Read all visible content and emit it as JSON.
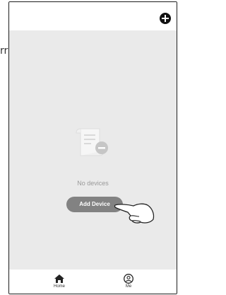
{
  "background_fragment": "rr",
  "header": {
    "add_icon": "plus-circle-icon"
  },
  "empty_state": {
    "icon": "document-minus-icon",
    "message": "No devices",
    "button_label": "Add Device",
    "pointer_icon": "hand-pointer-icon"
  },
  "tabs": [
    {
      "label": "Home",
      "icon": "home-icon"
    },
    {
      "label": "Me",
      "icon": "user-icon"
    }
  ]
}
